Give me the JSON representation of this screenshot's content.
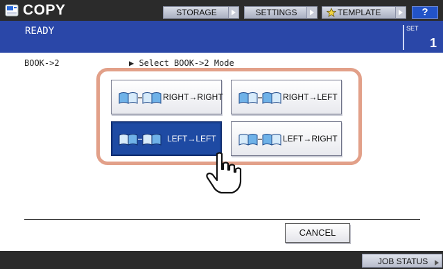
{
  "header": {
    "title": "COPY",
    "app_icon": "copier-icon",
    "buttons": [
      {
        "label": "STORAGE"
      },
      {
        "label": "SETTINGS"
      },
      {
        "label": "TEMPLATE",
        "icon": "star-icon"
      }
    ],
    "help_label": "?"
  },
  "status": {
    "text": "READY",
    "set_label": "SET",
    "set_value": "1"
  },
  "main": {
    "mode_name": "BOOK->2",
    "instruction": "▶ Select BOOK->2 Mode",
    "options": [
      {
        "label": "RIGHT→RIGHT",
        "selected": false
      },
      {
        "label": "RIGHT→LEFT",
        "selected": false
      },
      {
        "label": "LEFT→LEFT",
        "selected": true
      },
      {
        "label": "LEFT→RIGHT",
        "selected": false
      }
    ],
    "cancel_label": "CANCEL"
  },
  "footer": {
    "job_status_label": "JOB STATUS"
  },
  "colors": {
    "topbar": "#2b2b2b",
    "status_bar": "#2a47a8",
    "selected_option": "#1e4aa3",
    "highlight_ring": "#e2a089",
    "help_button": "#2253c7"
  }
}
